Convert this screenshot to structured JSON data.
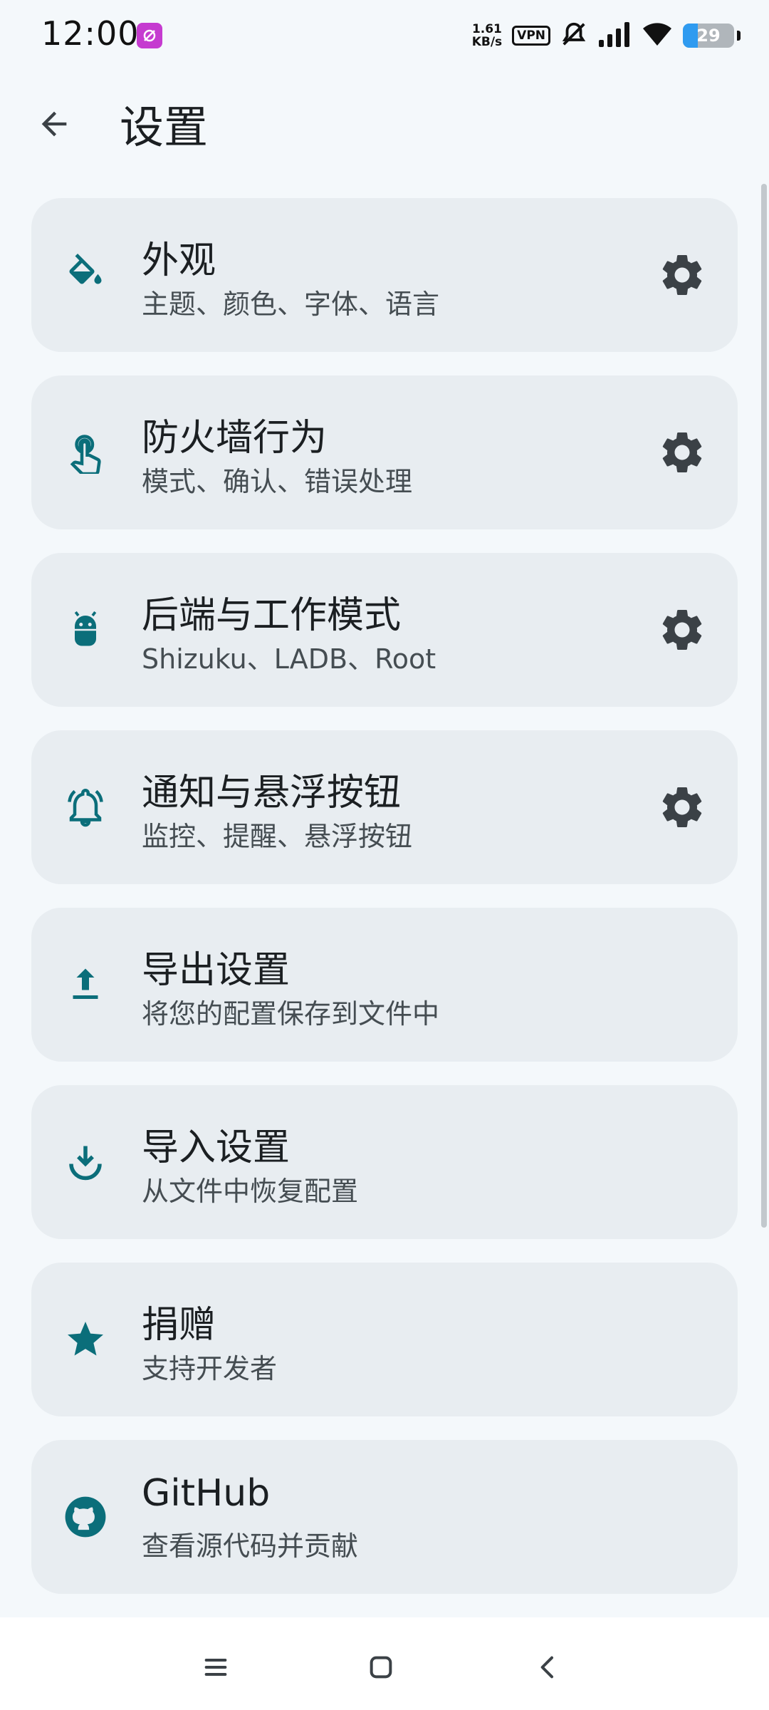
{
  "status_bar": {
    "time": "12:00",
    "net_speed_value": "1.61",
    "net_speed_unit": "KB/s",
    "vpn": "VPN",
    "battery": "29",
    "battery_level": 0.29
  },
  "header": {
    "title": "设置"
  },
  "colors": {
    "accent": "#0b6e7a",
    "card": "#e8edf1",
    "background": "#f4f8fb",
    "gear": "#3b4146"
  },
  "settings": [
    {
      "title": "外观",
      "subtitle": "主题、颜色、字体、语言",
      "icon": "paint-bucket-icon",
      "has_gear": true
    },
    {
      "title": "防火墙行为",
      "subtitle": "模式、确认、错误处理",
      "icon": "touch-app-icon",
      "has_gear": true
    },
    {
      "title": "后端与工作模式",
      "subtitle": "Shizuku、LADB、Root",
      "icon": "android-icon",
      "has_gear": true
    },
    {
      "title": "通知与悬浮按钮",
      "subtitle": "监控、提醒、悬浮按钮",
      "icon": "notification-bell-icon",
      "has_gear": true
    },
    {
      "title": "导出设置",
      "subtitle": "将您的配置保存到文件中",
      "icon": "upload-icon",
      "has_gear": false
    },
    {
      "title": "导入设置",
      "subtitle": "从文件中恢复配置",
      "icon": "download-icon",
      "has_gear": false
    },
    {
      "title": "捐赠",
      "subtitle": "支持开发者",
      "icon": "star-icon",
      "has_gear": false
    },
    {
      "title": "GitHub",
      "subtitle": "查看源代码并贡献",
      "icon": "github-icon",
      "has_gear": false
    }
  ],
  "nav_bar": {
    "icons": [
      "menu-icon",
      "home-icon",
      "back-icon"
    ]
  }
}
